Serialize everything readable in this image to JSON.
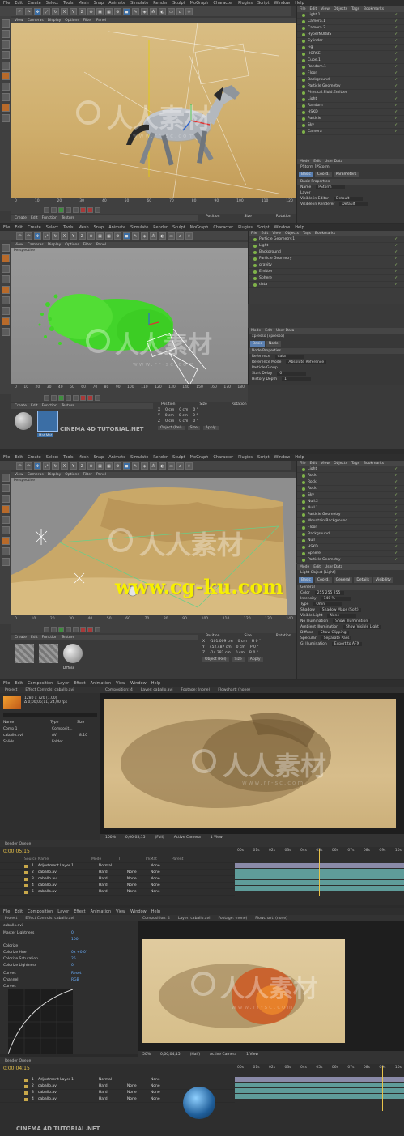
{
  "panel1": {
    "menu": [
      "File",
      "Edit",
      "Create",
      "Select",
      "Tools",
      "Mesh",
      "Snap",
      "Animate",
      "Simulate",
      "Render",
      "Sculpt",
      "MoGraph",
      "Character",
      "Plugins",
      "Script",
      "Window",
      "Help"
    ],
    "view_menu": [
      "View",
      "Cameras",
      "Display",
      "Options",
      "Filter",
      "Panel"
    ],
    "om_head": [
      "File",
      "Edit",
      "View",
      "Objects",
      "Tags",
      "Bookmarks"
    ],
    "objects": [
      "Light.1",
      "Camera.1",
      "Camera.2",
      "HyperNURBS",
      "Cylinder",
      "Fig",
      "HORSE",
      "Cube.1",
      "Random.1",
      "Floor",
      "Background",
      "Particle Geometry",
      "Physical.Fluid.Emitter",
      "Light",
      "Random",
      "HSKD",
      "Particle",
      "Sky",
      "Camera"
    ],
    "attr_head": [
      "Mode",
      "Edit",
      "User Data"
    ],
    "attr_title": "PStorm [PStorm]",
    "attr_tabs": [
      "Basic",
      "Coord.",
      "Parameters"
    ],
    "attr_section": "Basic Properties",
    "attr_rows": [
      {
        "k": "Name",
        "v": "PStorm"
      },
      {
        "k": "Layer",
        "v": ""
      },
      {
        "k": "Visible in Editor",
        "v": "Default"
      },
      {
        "k": "Visible in Renderer",
        "v": "Default"
      }
    ],
    "ruler": [
      "0",
      "10",
      "20",
      "30",
      "40",
      "50",
      "60",
      "70",
      "80",
      "90",
      "100",
      "110",
      "120"
    ],
    "coord_head": [
      "Position",
      "Size",
      "Rotation"
    ],
    "tabs_bottom": [
      "Create",
      "Edit",
      "Function",
      "Texture"
    ]
  },
  "panel2": {
    "menu": [
      "File",
      "Edit",
      "Create",
      "Select",
      "Tools",
      "Mesh",
      "Snap",
      "Animate",
      "Simulate",
      "Render",
      "Sculpt",
      "MoGraph",
      "Character",
      "Plugins",
      "Script",
      "Window",
      "Help"
    ],
    "view_menu": [
      "View",
      "Cameras",
      "Display",
      "Options",
      "Filter",
      "Panel"
    ],
    "view_label": "Perspective",
    "om_head": [
      "File",
      "Edit",
      "View",
      "Objects",
      "Tags",
      "Bookmarks"
    ],
    "objects": [
      "Particle Geometry.1",
      "Light",
      "Background",
      "Particle Geometry",
      "gravity",
      "Emitter",
      "Sphere",
      "data"
    ],
    "attr_head": [
      "Mode",
      "Edit",
      "User Data"
    ],
    "attr_title": "xpresso [xpresso]",
    "attr_tabs": [
      "Basic",
      "Node"
    ],
    "attr_section": "Node Properties",
    "attr_rows": [
      {
        "k": "Reference",
        "v": "data"
      },
      {
        "k": "Reference Mode",
        "v": "Absolute Reference"
      },
      {
        "k": "Particle Group",
        "v": ""
      },
      {
        "k": "Start Delay",
        "v": "0"
      },
      {
        "k": "History Depth",
        "v": "1"
      }
    ],
    "ruler": [
      "0",
      "10",
      "20",
      "30",
      "40",
      "50",
      "60",
      "70",
      "80",
      "90",
      "100",
      "110",
      "120",
      "130",
      "140",
      "150",
      "160",
      "170",
      "180"
    ],
    "coord_head": [
      "Position",
      "Size",
      "Rotation"
    ],
    "coord_rows": [
      [
        "X",
        "0 cm",
        "0 cm",
        "0 °"
      ],
      [
        "Y",
        "0 cm",
        "0 cm",
        "0 °"
      ],
      [
        "Z",
        "0 cm",
        "0 cm",
        "0 °"
      ]
    ],
    "coord_buttons": [
      "Object (Rel)",
      "Size",
      "Apply"
    ],
    "tabs_bottom": [
      "Create",
      "Edit",
      "Function",
      "Texture"
    ],
    "mat_label": "Mat Mat"
  },
  "panel3": {
    "menu": [
      "File",
      "Edit",
      "Create",
      "Select",
      "Tools",
      "Mesh",
      "Snap",
      "Animate",
      "Simulate",
      "Render",
      "Sculpt",
      "MoGraph",
      "Character",
      "Plugins",
      "Script",
      "Window",
      "Help"
    ],
    "view_menu": [
      "View",
      "Cameras",
      "Display",
      "Options",
      "Filter",
      "Panel"
    ],
    "view_label": "Perspective",
    "om_head": [
      "File",
      "Edit",
      "View",
      "Objects",
      "Tags",
      "Bookmarks"
    ],
    "objects": [
      "Light",
      "Rock",
      "Rock",
      "Rock",
      "Sky",
      "Null.2",
      "Null.1",
      "Particle Geometry",
      "Mountain.Background",
      "Floor",
      "Background",
      "Null",
      "HSKD",
      "Sphere",
      "Particle Geometry"
    ],
    "attr_head": [
      "Mode",
      "Edit",
      "User Data"
    ],
    "attr_title": "Light Object [Light]",
    "attr_tabs": [
      "Basic",
      "Coord.",
      "General",
      "Details",
      "Visibility"
    ],
    "attr_section": "General",
    "attr_rows": [
      {
        "k": "Color",
        "v": "255 255 255"
      },
      {
        "k": "Intensity",
        "v": "140 %"
      },
      {
        "k": "Type",
        "v": "Omni"
      },
      {
        "k": "Shadow",
        "v": "Shadow Maps (Soft)"
      },
      {
        "k": "Visible Light",
        "v": "None"
      },
      {
        "k": "No Illumination",
        "v": "Show Illumination"
      },
      {
        "k": "Ambient Illumination",
        "v": "Show Visible Light"
      },
      {
        "k": "Diffuse",
        "v": "Show Clipping"
      },
      {
        "k": "Specular",
        "v": "Separate Pass"
      },
      {
        "k": "GI Illumination",
        "v": "Export to AFX"
      }
    ],
    "ruler": [
      "0",
      "10",
      "20",
      "30",
      "40",
      "50",
      "60",
      "70",
      "80",
      "90",
      "100",
      "110",
      "120",
      "130",
      "140"
    ],
    "coord_head": [
      "Position",
      "Size",
      "Rotation"
    ],
    "coord_rows": [
      [
        "X",
        "-101.009 cm",
        "0 cm",
        "H 0 °"
      ],
      [
        "Y",
        "452.487 cm",
        "0 cm",
        "P 0 °"
      ],
      [
        "Z",
        "-14.282 cm",
        "0 cm",
        "B 0 °"
      ]
    ],
    "coord_buttons": [
      "Object (Rel)",
      "Size",
      "Apply"
    ],
    "tabs_bottom": [
      "Create",
      "Edit",
      "Function",
      "Texture"
    ],
    "mat_label": "Diffuse"
  },
  "panel4": {
    "menu": [
      "File",
      "Edit",
      "Composition",
      "Layer",
      "Effect",
      "Animation",
      "View",
      "Window",
      "Help"
    ],
    "project_tabs": [
      "Project",
      "Effect Controls: caballo.avi"
    ],
    "footage_info": [
      "1280 x 720 (1.00)",
      "Δ 0;00;05;11, 24,00 fps"
    ],
    "project_cols": [
      "Name",
      "Type",
      "Size"
    ],
    "project_items": [
      {
        "n": "Comp 1",
        "t": "Composit...",
        "s": ""
      },
      {
        "n": "caballo.avi",
        "t": "AVI",
        "s": "8.10"
      },
      {
        "n": "Solids",
        "t": "Folder",
        "s": ""
      }
    ],
    "comp_tabs": [
      "Composition: 4",
      "Layer: caballo.avi",
      "Footage: (none)",
      "Flowchart: (none)"
    ],
    "viewer_bar": [
      "100%",
      "0;00;05;15",
      "(Full)",
      "Active Camera",
      "1 View"
    ],
    "time": "0;00;05;15",
    "timeline_tab": "Render Queue",
    "layer_cols": [
      "Source Name",
      "Mode",
      "T",
      "TrkMat",
      "Parent"
    ],
    "layers": [
      {
        "num": "1",
        "name": "Adjustment Layer 1",
        "mode": "Normal",
        "trk": "",
        "parent": "None"
      },
      {
        "num": "2",
        "name": "caballo.avi",
        "mode": "Hard",
        "trk": "None",
        "parent": "None"
      },
      {
        "num": "3",
        "name": "caballo.avi",
        "mode": "Hard",
        "trk": "None",
        "parent": "None"
      },
      {
        "num": "4",
        "name": "caballo.avi",
        "mode": "Hard",
        "trk": "None",
        "parent": "None"
      },
      {
        "num": "5",
        "name": "caballo.avi",
        "mode": "Hard",
        "trk": "None",
        "parent": "None"
      }
    ],
    "ruler": [
      "00s",
      "01s",
      "02s",
      "03s",
      "04s",
      "05s",
      "06s",
      "07s",
      "08s",
      "09s",
      "10s"
    ]
  },
  "panel5": {
    "menu": [
      "File",
      "Edit",
      "Composition",
      "Layer",
      "Effect",
      "Animation",
      "View",
      "Window",
      "Help"
    ],
    "project_tabs": [
      "Project",
      "Effect Controls: caballo.avi"
    ],
    "effect_title": "caballo.avi",
    "effect_rows": [
      {
        "k": "Master Lightness",
        "v": "0"
      },
      {
        "k": "",
        "v": "100"
      },
      {
        "k": "Colorize",
        "v": ""
      },
      {
        "k": "Colorize Hue",
        "v": "0x +0.0°"
      },
      {
        "k": "Colorize Saturation",
        "v": "25"
      },
      {
        "k": "Colorize Lightness",
        "v": "0"
      }
    ],
    "effect_sections": [
      {
        "name": "Curves",
        "reset": "Reset"
      },
      {
        "name": "Channel:",
        "reset": "RGB"
      },
      {
        "name": "Curves",
        "reset": ""
      }
    ],
    "comp_tabs": [
      "Composition: 4",
      "Layer: caballo.avi",
      "Footage: (none)",
      "Flowchart: (none)"
    ],
    "viewer_bar": [
      "50%",
      "0;00;04;15",
      "(Half)",
      "Active Camera",
      "1 View"
    ],
    "time": "0;00;04;15",
    "timeline_tab": "Render Queue",
    "layers": [
      {
        "num": "1",
        "name": "Adjustment Layer 1",
        "mode": "Normal",
        "trk": "",
        "parent": "None"
      },
      {
        "num": "2",
        "name": "caballo.avi",
        "mode": "Hard",
        "trk": "None",
        "parent": "None"
      },
      {
        "num": "3",
        "name": "caballo.avi",
        "mode": "Hard",
        "trk": "None",
        "parent": "None"
      },
      {
        "num": "4",
        "name": "caballo.avi",
        "mode": "Hard",
        "trk": "None",
        "parent": "None"
      }
    ],
    "ruler": [
      "00s",
      "01s",
      "02s",
      "03s",
      "04s",
      "05s",
      "06s",
      "07s",
      "08s",
      "09s",
      "10s"
    ]
  },
  "watermarks": {
    "cn": "人人素材",
    "sub": "www.rr-sc.com",
    "cg": "www.cg-ku.com",
    "tutorial": "CINEMA 4D TUTORIAL.NET"
  },
  "colors": {
    "sand": "#c8a765",
    "sand_light": "#d9bd83",
    "viewport_grey": "#8a8a8a",
    "particles_green": "#42d42a",
    "ae_track": "#5f9c9a",
    "accent_blue": "#3b6ea5"
  }
}
